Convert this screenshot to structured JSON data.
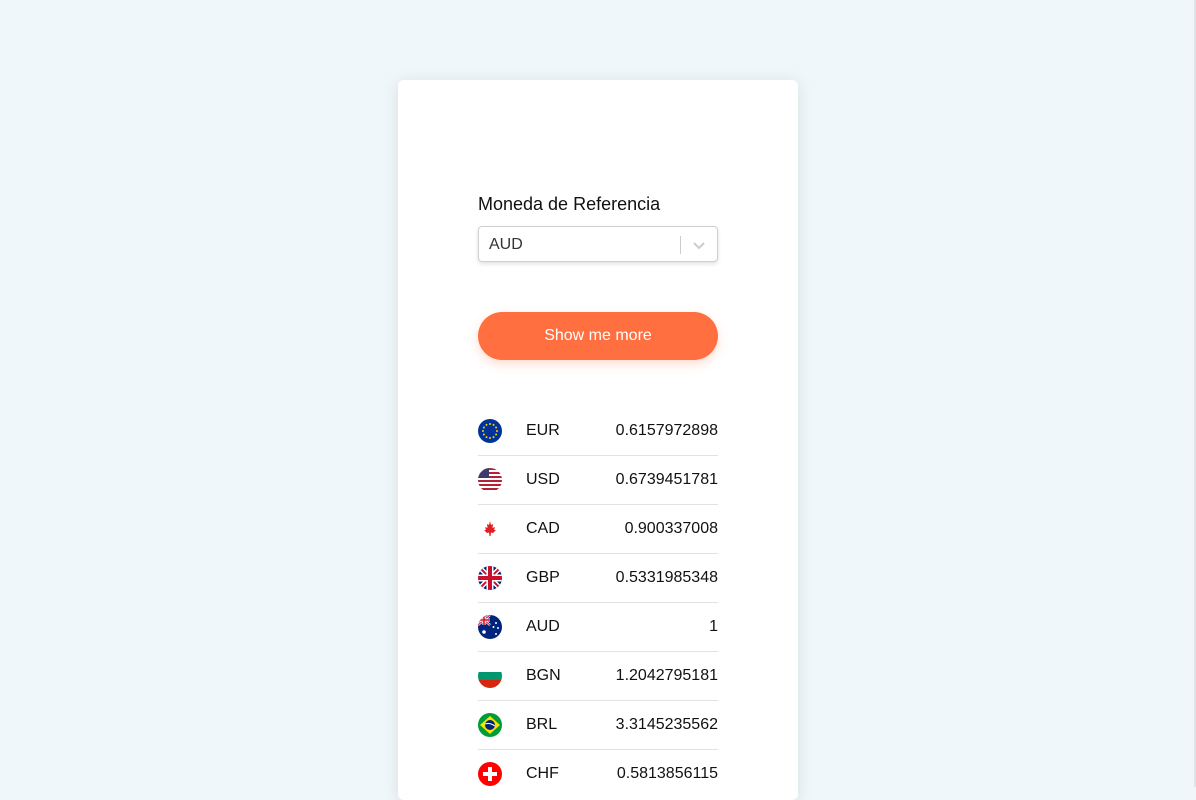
{
  "reference": {
    "label": "Moneda de Referencia",
    "selected": "AUD"
  },
  "button": {
    "label": "Show me more",
    "color": "#ff6f3f"
  },
  "rates": [
    {
      "code": "EUR",
      "value": "0.6157972898",
      "flag": "eu-flag-icon"
    },
    {
      "code": "USD",
      "value": "0.6739451781",
      "flag": "us-flag-icon"
    },
    {
      "code": "CAD",
      "value": "0.900337008",
      "flag": "canada-flag-icon"
    },
    {
      "code": "GBP",
      "value": "0.5331985348",
      "flag": "uk-flag-icon"
    },
    {
      "code": "AUD",
      "value": "1",
      "flag": "australia-flag-icon"
    },
    {
      "code": "BGN",
      "value": "1.2042795181",
      "flag": "bulgaria-flag-icon"
    },
    {
      "code": "BRL",
      "value": "3.3145235562",
      "flag": "brazil-flag-icon"
    },
    {
      "code": "CHF",
      "value": "0.5813856115",
      "flag": "switzerland-flag-icon"
    }
  ]
}
